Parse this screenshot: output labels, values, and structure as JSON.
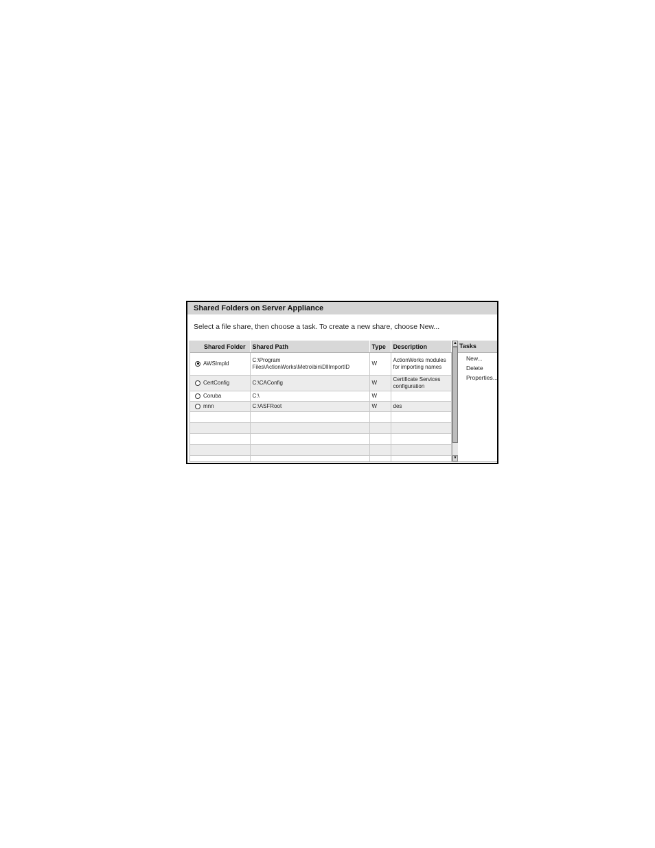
{
  "panel": {
    "title": "Shared Folders on Server Appliance",
    "instructions": "Select a file share, then choose a task. To create a new share, choose New..."
  },
  "table": {
    "columns": [
      "Shared Folder",
      "Shared Path",
      "Type",
      "Description"
    ],
    "rows": [
      {
        "folder": "AWSImpld",
        "path": "C:\\Program Files\\ActionWorks\\Metro\\bin\\DllImportID",
        "type": "W",
        "description": "ActionWorks modules for importing names",
        "selected": true
      },
      {
        "folder": "CertConfig",
        "path": "C:\\CAConfig",
        "type": "W",
        "description": "Certificate Services configuration",
        "selected": false
      },
      {
        "folder": "Coruba",
        "path": "C:\\",
        "type": "W",
        "description": "",
        "selected": false
      },
      {
        "folder": "mnn",
        "path": "C:\\ASFRoot",
        "type": "W",
        "description": "des",
        "selected": false
      }
    ]
  },
  "tasks": {
    "header": "Tasks",
    "items": [
      "New...",
      "Delete",
      "Properties..."
    ]
  },
  "icons": {
    "scroll_up": "scroll-up-arrow-icon",
    "scroll_down": "scroll-down-arrow-icon",
    "radio": "radio-button-icon"
  }
}
